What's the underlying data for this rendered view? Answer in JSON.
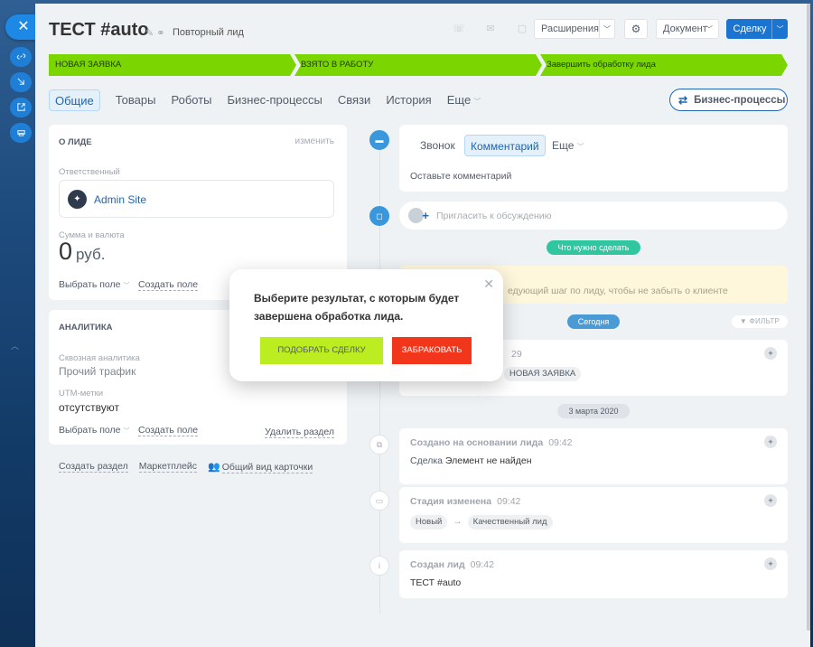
{
  "lead": {
    "title": "ТЕСТ #auto",
    "repeat_label": "Повторный лид"
  },
  "header": {
    "extensions_label": "Расширения",
    "document_label": "Документ",
    "deal_label": "Сделку"
  },
  "stages": [
    {
      "label": "НОВАЯ ЗАЯВКА"
    },
    {
      "label": "ВЗЯТО В РАБОТУ"
    },
    {
      "label": "Завершить обработку лида"
    }
  ],
  "tabs": {
    "general": "Общие",
    "products": "Товары",
    "robots": "Роботы",
    "bp": "Бизнес-процессы",
    "links": "Связи",
    "history": "История",
    "more": "Еще"
  },
  "bp_button_label": "Бизнес-процессы",
  "about": {
    "heading": "О ЛИДЕ",
    "edit": "изменить",
    "responsible_label": "Ответственный",
    "responsible_name": "Admin Site",
    "amount_label": "Сумма и валюта",
    "amount_value": "0",
    "currency": "руб.",
    "choose_field": "Выбрать поле",
    "create_field": "Создать поле"
  },
  "analytics": {
    "heading": "АНАЛИТИКА",
    "through_label": "Сквозная аналитика",
    "through_value": "Прочий трафик",
    "utm_label": "UTM-метки",
    "utm_value": "отсутствуют",
    "choose_field": "Выбрать поле",
    "create_field": "Создать поле",
    "delete_section": "Удалить раздел"
  },
  "bottom_links": {
    "create_section": "Создать раздел",
    "marketplace": "Маркетплейс",
    "card_view": "Общий вид карточки"
  },
  "comment": {
    "tab_call": "Звонок",
    "tab_comment": "Комментарий",
    "tab_more": "Еще",
    "placeholder": "Оставьте комментарий"
  },
  "invite_text": "Пригласить к обсуждению",
  "todo_pill": "Что нужно сделать",
  "todo_text": "едующий шаг по лиду, чтобы не забыть о клиенте",
  "today_pill": "Сегодня",
  "filter_label": "ФИЛЬТР",
  "event_today": {
    "time": "29",
    "chip": "НОВАЯ ЗАЯВКА"
  },
  "date_pill": "3 марта 2020",
  "events": [
    {
      "title": "Создано на основании лида",
      "time": "09:42",
      "body_prefix": "Сделка",
      "body_value": "Элемент не найден"
    },
    {
      "title": "Стадия изменена",
      "time": "09:42",
      "from": "Новый",
      "arrow": "→",
      "to": "Качественный лид"
    },
    {
      "title": "Создан лид",
      "time": "09:42",
      "body_value": "ТЕСТ #auto"
    }
  ],
  "popup": {
    "message": "Выберите результат, с которым будет завершена обработка лида.",
    "btn_deal": "ПОДОБРАТЬ СДЕЛКУ",
    "btn_reject": "ЗАБРАКОВАТЬ"
  },
  "colors": {
    "stage": "#7bd500",
    "accent": "#1a74d0",
    "reject": "#f1361b",
    "select": "#bbed21"
  }
}
